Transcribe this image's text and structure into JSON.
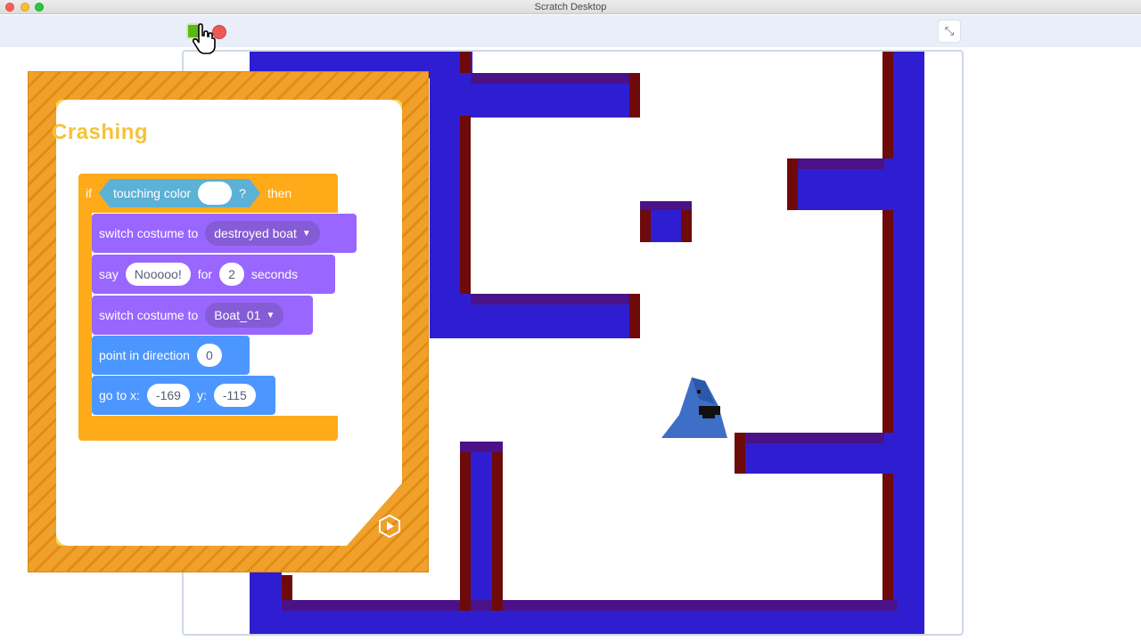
{
  "window": {
    "title": "Scratch Desktop"
  },
  "toolbar": {
    "green_flag_icon": "green-flag-icon",
    "stop_icon": "stop-icon",
    "unfullscreen_symbol": "⤡"
  },
  "card": {
    "title": "Crashing",
    "blocks": {
      "if_label": "if",
      "touching_color_label": "touching color",
      "question": "?",
      "then_label": "then",
      "switch_costume_1_label": "switch costume to",
      "switch_costume_1_value": "destroyed boat",
      "say_label": "say",
      "say_text": "Nooooo!",
      "for_label": "for",
      "say_seconds": "2",
      "seconds_label": "seconds",
      "switch_costume_2_label": "switch costume to",
      "switch_costume_2_value": "Boat_01",
      "point_label": "point in direction",
      "point_value": "0",
      "goto_label": "go to x:",
      "goto_x": "-169",
      "y_label": "y:",
      "goto_y": "-115"
    },
    "colors": {
      "control": "#ffab19",
      "looks": "#9966ff",
      "motion": "#4c97ff",
      "sensing": "#5cb1d6"
    }
  },
  "stage": {
    "colors": {
      "water": "#2f1ed1",
      "wall_edge": "#6e0a0a",
      "wall_top": "#4b1187",
      "background": "#ffffff"
    }
  }
}
